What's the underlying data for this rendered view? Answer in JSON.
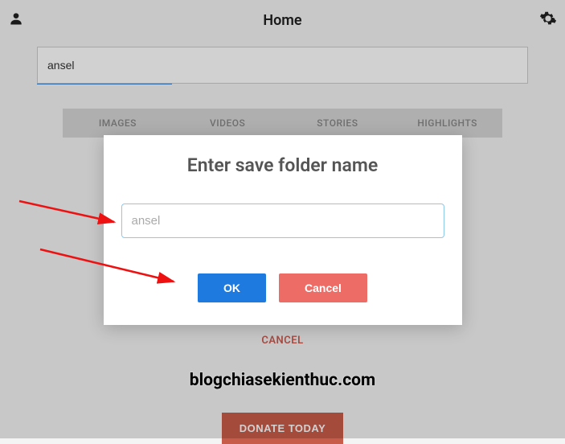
{
  "header": {
    "title": "Home"
  },
  "search": {
    "value": "ansel"
  },
  "tabs": [
    {
      "label": "IMAGES"
    },
    {
      "label": "VIDEOS"
    },
    {
      "label": "STORIES"
    },
    {
      "label": "HIGHLIGHTS"
    }
  ],
  "cancel_link": "CANCEL",
  "watermark": "blogchiasekienthuc.com",
  "donate": {
    "label": "DONATE TODAY"
  },
  "modal": {
    "title": "Enter save folder name",
    "input_value": "ansel",
    "ok_label": "OK",
    "cancel_label": "Cancel"
  }
}
